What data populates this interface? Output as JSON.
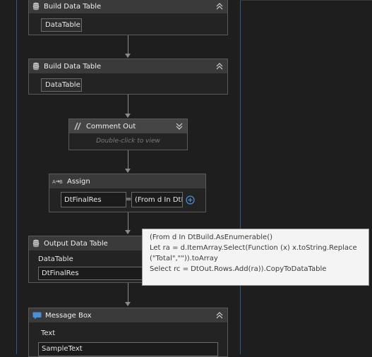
{
  "activities": {
    "build_table_1": {
      "title": "Build Data Table",
      "button": "DataTable..."
    },
    "build_table_2": {
      "title": "Build Data Table",
      "button": "DataTable..."
    },
    "comment_out": {
      "title": "Comment Out",
      "hint": "Double-click to view"
    },
    "assign": {
      "title": "Assign",
      "to_value": "DtFinalRes",
      "equals": "=",
      "value_expr": "(From d In DtB"
    },
    "output_table": {
      "title": "Output Data Table",
      "field_label": "DataTable",
      "field_value": "DtFinalRes"
    },
    "message_box": {
      "title": "Message Box",
      "field_label": "Text",
      "field_value": "SampleText"
    }
  },
  "tooltip": {
    "lines": [
      "(From d In DtBuild.AsEnumerable()",
      "Let ra = d.ItemArray.Select(Function (x) x.toString.Replace",
      "(\"Total\",\"\")).toArray",
      "Select rc = DtOut.Rows.Add(ra)).CopyToDataTable"
    ]
  },
  "icons": {
    "database": "database-icon",
    "comment": "comment-out-icon",
    "assign": "assign-icon",
    "message": "message-icon",
    "collapse": "collapse-icon",
    "expand": "expand-icon",
    "add": "add-icon"
  },
  "colors": {
    "canvas": "#1e1e1e",
    "header": "#3a3a3a",
    "sequence_line": "#2e5c86",
    "accent": "#4a90d9",
    "tooltip_bg": "#f4f4f4"
  }
}
